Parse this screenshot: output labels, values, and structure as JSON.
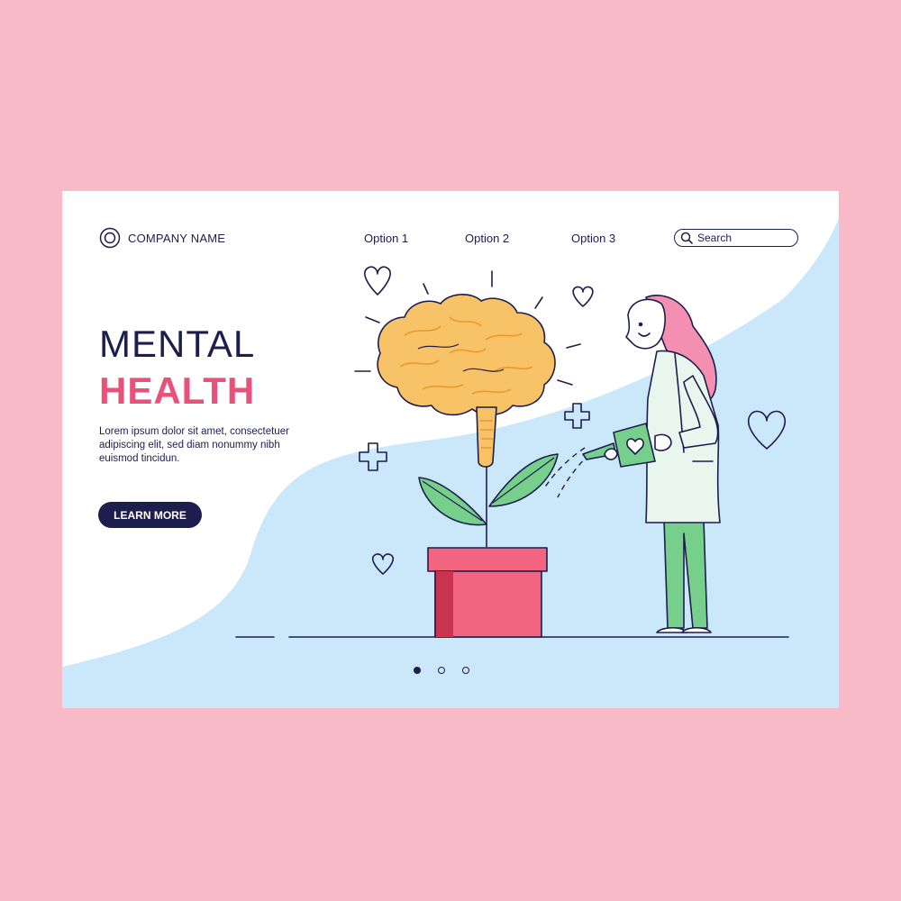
{
  "colors": {
    "frame": "#f9bac7",
    "page": "#ffffff",
    "wave": "#cbe7fa",
    "navy": "#1d1d4e",
    "accent_pink": "#e8527a",
    "brain": "#f8b64c",
    "leaf": "#76cf8a",
    "pot": "#f2647f"
  },
  "header": {
    "logo_icon": "circle-target-icon",
    "company": "COMPANY NAME",
    "menu": [
      "Option 1",
      "Option 2",
      "Option 3"
    ],
    "search_placeholder": "Search"
  },
  "hero": {
    "title_line1": "MENTAL",
    "title_line2": "HEALTH",
    "body": "Lorem ipsum dolor sit amet, consectetuer adipiscing elit, sed diam nonummy nibh euismod tincidun.",
    "cta": "LEARN MORE"
  },
  "pagination": {
    "total": 3,
    "active": 1
  },
  "illustration": {
    "items": [
      "heart-icon",
      "plus-icon",
      "brain-icon",
      "leaf-icon",
      "flower-pot-icon",
      "doctor-figure",
      "watering-can-icon"
    ]
  }
}
